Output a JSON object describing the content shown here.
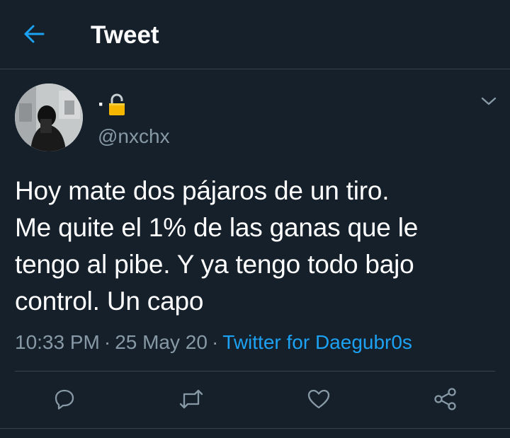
{
  "header": {
    "title": "Tweet",
    "back_icon": "arrow-left-icon"
  },
  "author": {
    "display_name": "·",
    "badge_icon": "lock-icon",
    "handle": "@nxchx",
    "avatar": "avatar-photo"
  },
  "tweet": {
    "text": "Hoy mate dos pájaros de un tiro.\nMe quite el 1% de las ganas que le\ntengo al pibe. Y ya tengo todo bajo\ncontrol. Un capo"
  },
  "meta": {
    "time": "10:33 PM",
    "separator": "·",
    "date": "25 May 20",
    "source": "Twitter for Daegubr0s"
  },
  "actions": {
    "reply_icon": "reply-icon",
    "retweet_icon": "retweet-icon",
    "like_icon": "heart-icon",
    "share_icon": "share-icon"
  },
  "colors": {
    "background": "#15202b",
    "accent": "#1da1f2",
    "secondary_text": "#8899a6",
    "divider": "#38444d",
    "lock": "#f5b700"
  }
}
